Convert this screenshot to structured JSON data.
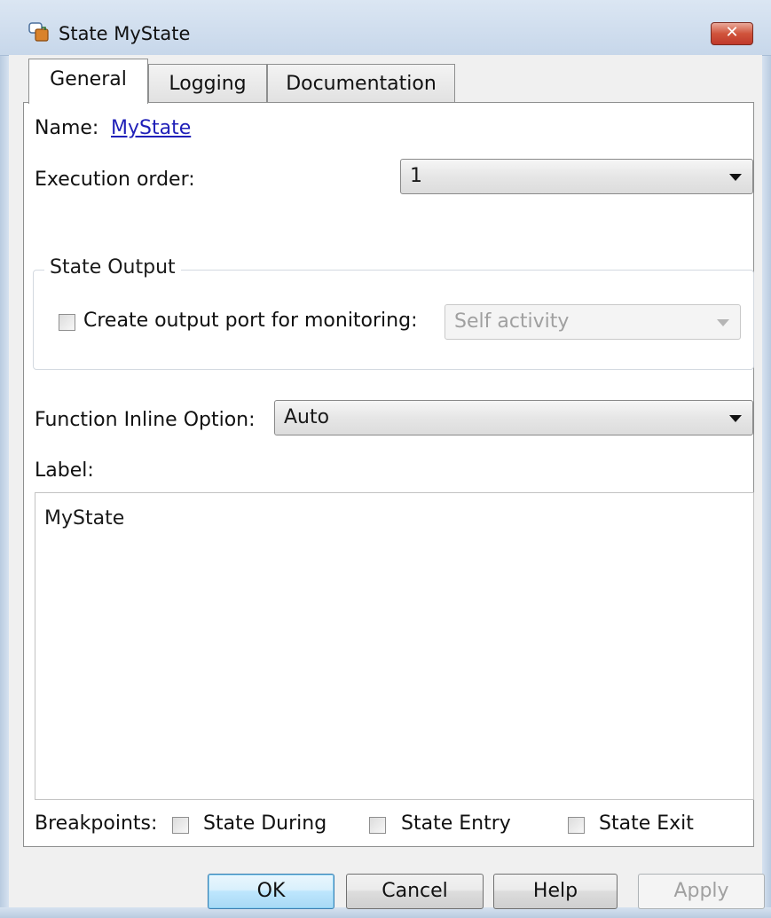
{
  "window": {
    "title": "State MyState",
    "close_label": "✕",
    "icon": "stateflow-state-icon"
  },
  "tabs": [
    {
      "label": "General",
      "active": true
    },
    {
      "label": "Logging",
      "active": false
    },
    {
      "label": "Documentation",
      "active": false
    }
  ],
  "general": {
    "name_label": "Name:",
    "name_value": "MyState",
    "execution_order_label": "Execution order:",
    "execution_order_value": "1",
    "state_output_group": "State Output",
    "create_output_label": "Create output port for monitoring:",
    "create_output_checked": false,
    "monitoring_value": "Self activity",
    "inline_option_label": "Function Inline Option:",
    "inline_option_value": "Auto",
    "label_label": "Label:",
    "label_text": "MyState",
    "breakpoints_label": "Breakpoints:",
    "breakpoints": [
      {
        "label": "State During",
        "checked": false
      },
      {
        "label": "State Entry",
        "checked": false
      },
      {
        "label": "State Exit",
        "checked": false
      }
    ]
  },
  "buttons": {
    "ok": "OK",
    "cancel": "Cancel",
    "help": "Help",
    "apply": "Apply"
  },
  "colors": {
    "link": "#2020b8",
    "default_button_border": "#3c7fb1",
    "titlebar": "#c7d7ea"
  }
}
